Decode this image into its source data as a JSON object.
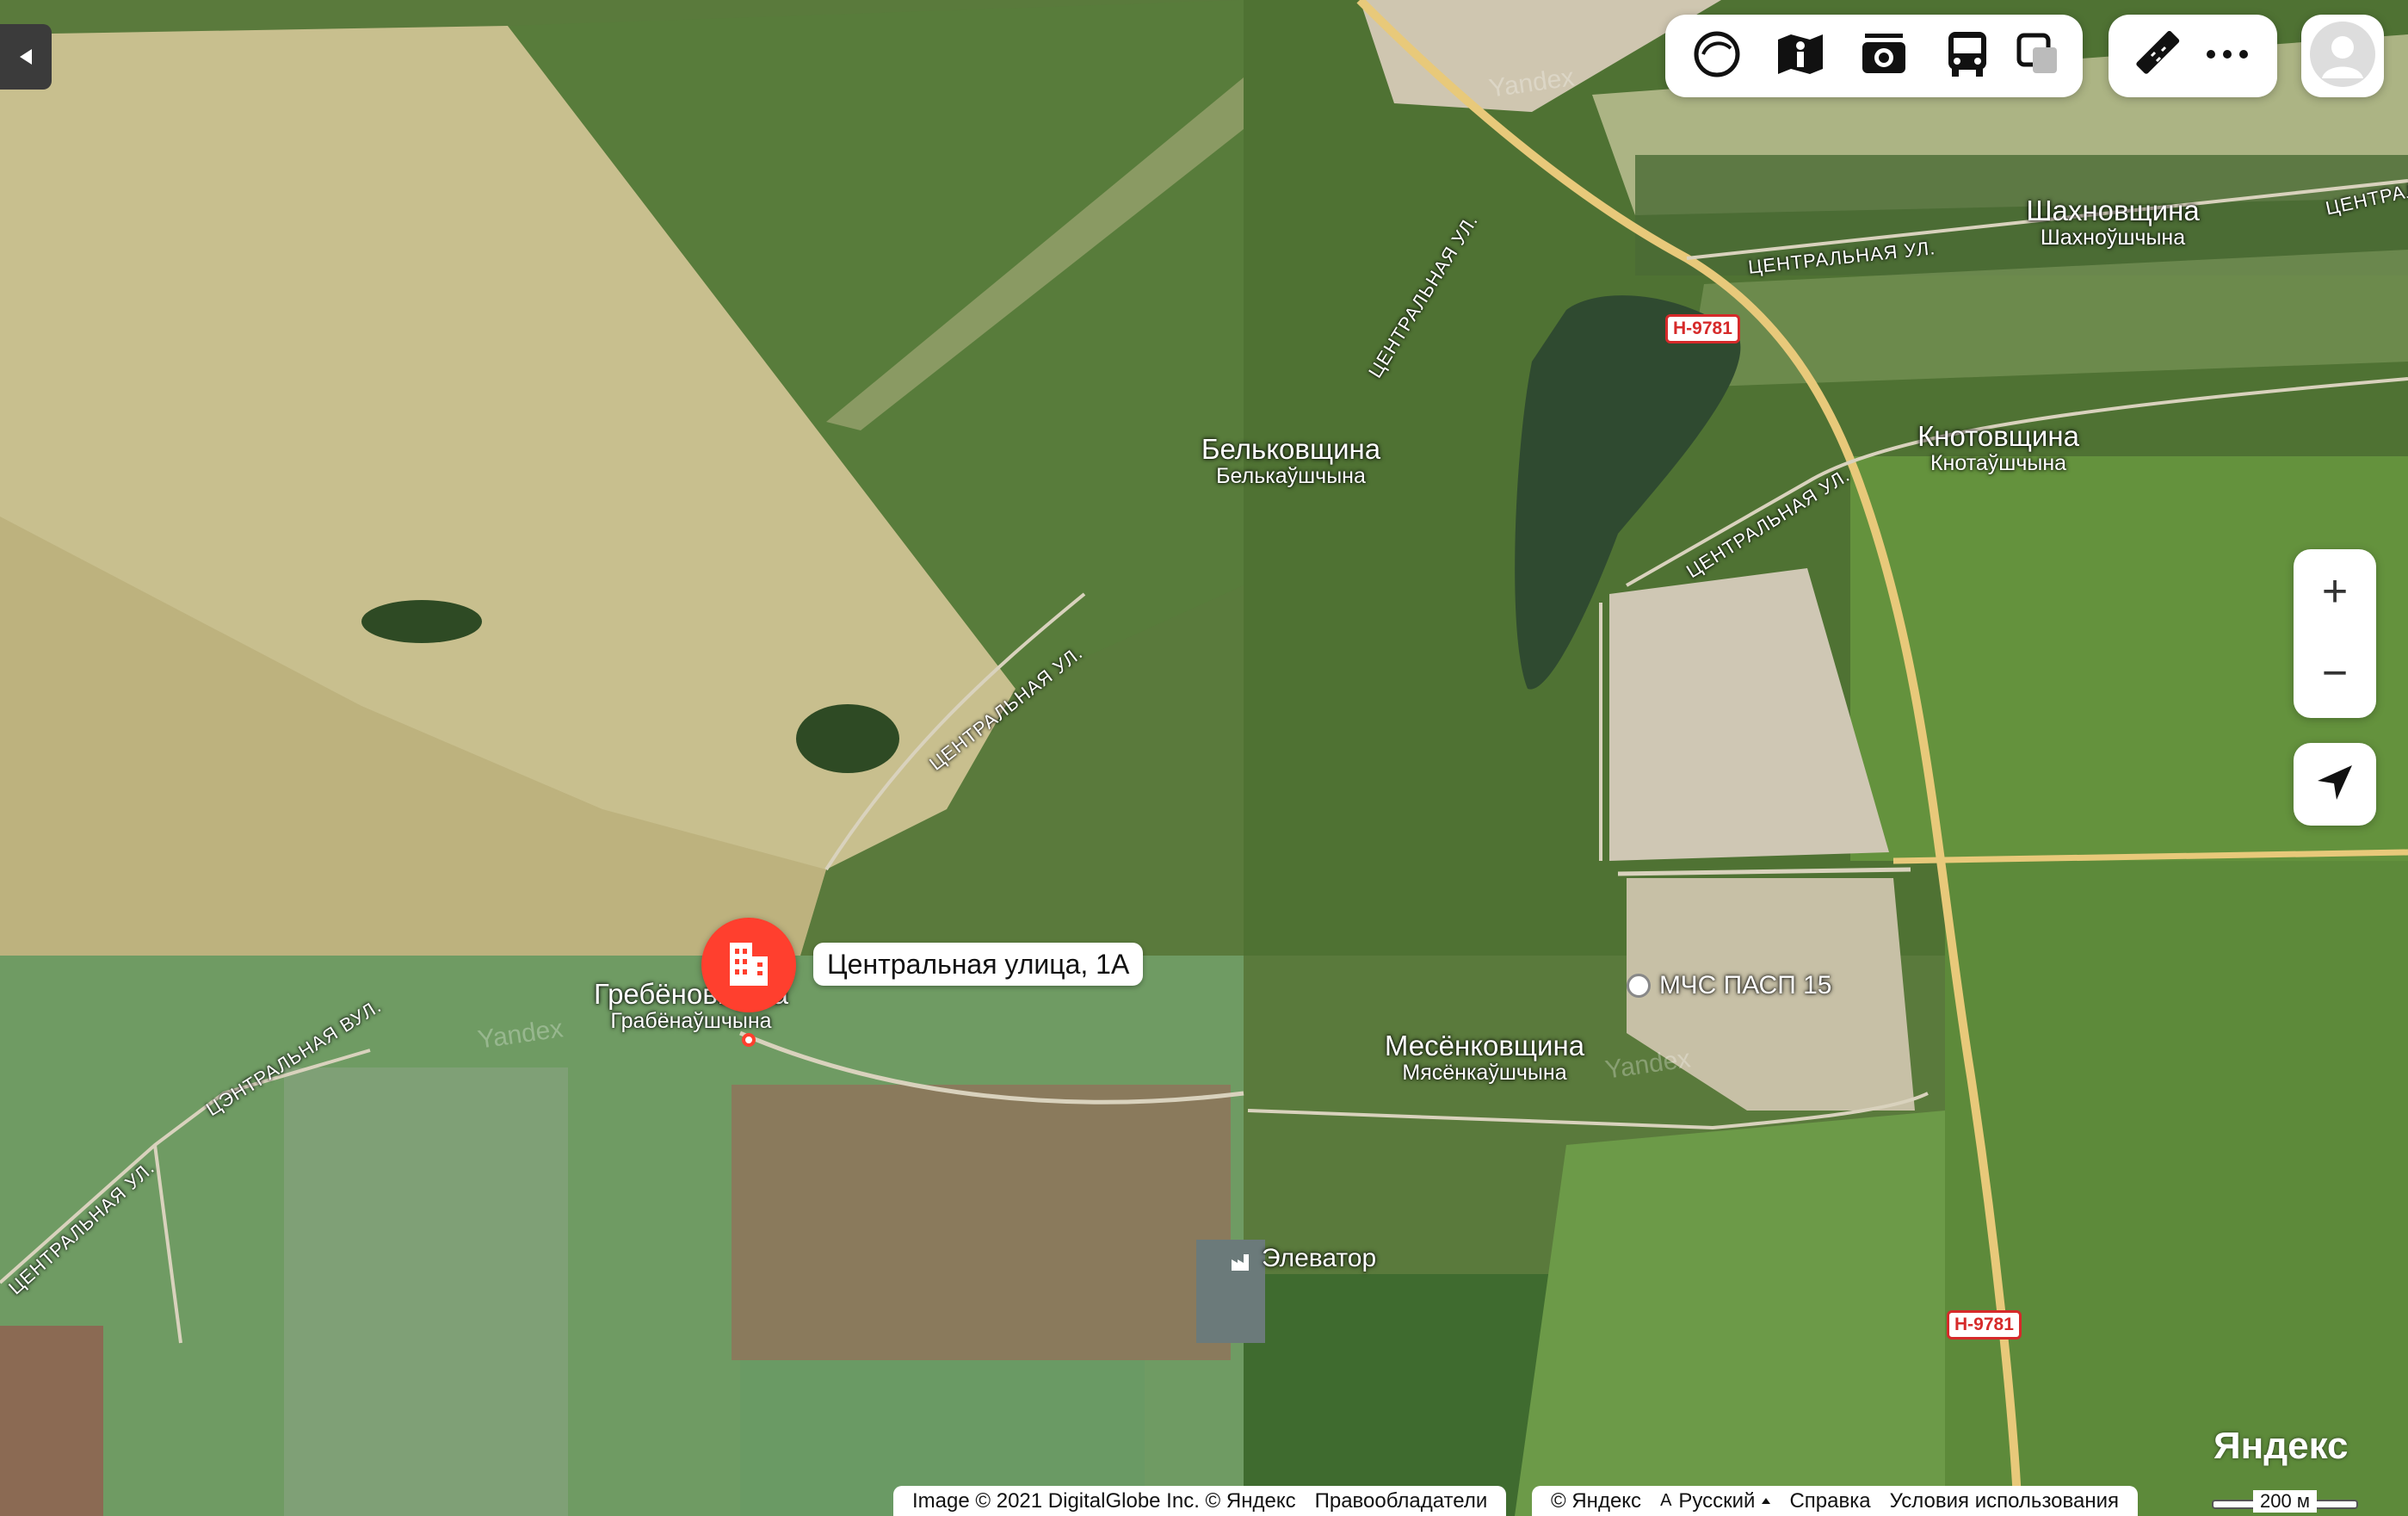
{
  "header": {
    "toolbar": {
      "icons": [
        "layers-icon",
        "panorama-person-icon",
        "camera-icon",
        "bus-icon",
        "traffic-layers-icon"
      ],
      "extra_icons": [
        "ruler-icon",
        "more-dots-icon"
      ]
    },
    "avatar": "user-avatar"
  },
  "map": {
    "places": [
      {
        "ru": "Шахновщина",
        "by": "Шахноўшчына"
      },
      {
        "ru": "Бельковщина",
        "by": "Белькаўшчына"
      },
      {
        "ru": "Кнотовщина",
        "by": "Кнотаўшчына"
      },
      {
        "ru": "Гребёновщина",
        "by": "Грабёнаўшчына"
      },
      {
        "ru": "Месёнковщина",
        "by": "Мясёнкаўшчына"
      }
    ],
    "streets": [
      "ЦЕНТРАЛЬНАЯ УЛ.",
      "ЦЕНТРАЛЬНАЯ УЛ.",
      "ЦЕНТРАЛЬНАЯ УЛ.",
      "ЦЕНТРАЛЬНАЯ УЛ.",
      "ЦЭНТРАЛЬНАЯ ВУЛ.",
      "ЦЕНТРАЛЬНАЯ УЛ.",
      "ЦЕНТРАЛ"
    ],
    "highways": [
      "Н-9781",
      "Н-9781"
    ],
    "pois": [
      {
        "label": "МЧС ПАСП 15",
        "icon": "fire-station-icon"
      },
      {
        "label": "Элеватор",
        "icon": "factory-icon"
      }
    ],
    "watermark": "Yandex",
    "selected_marker": {
      "label": "Центральная улица, 1А",
      "icon": "building-icon"
    }
  },
  "controls": {
    "zoom_in": "+",
    "zoom_out": "−",
    "locate_icon": "navigation-arrow-icon",
    "collapse_icon": "triangle-left-icon"
  },
  "footer": {
    "logo": "Яндекс",
    "image_credit": "Image © 2021 DigitalGlobe Inc. © Яндекс",
    "rights": "Правообладатели",
    "copyright": "© Яндекс",
    "language": "Русский",
    "help": "Справка",
    "terms": "Условия использования",
    "scale": "200 м"
  },
  "colors": {
    "accent": "#f43",
    "highway": "#d62a2a",
    "road": "#e8c97a"
  }
}
